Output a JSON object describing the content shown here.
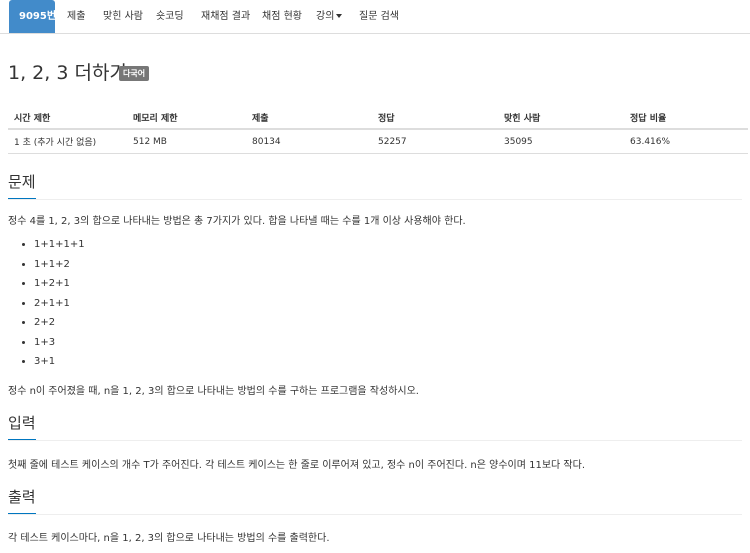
{
  "nav": {
    "tabs": [
      {
        "label": "9095번",
        "active": true
      },
      {
        "label": "제출"
      },
      {
        "label": "맞힌 사람"
      },
      {
        "label": "숏코딩"
      },
      {
        "label": "재채점 결과"
      },
      {
        "label": "채점 현황"
      },
      {
        "label": "강의",
        "dropdown": true
      },
      {
        "label": "질문 검색"
      }
    ]
  },
  "problem": {
    "title": "1, 2, 3 더하기",
    "badge": "다국어"
  },
  "info_table": {
    "headers": [
      "시간 제한",
      "메모리 제한",
      "제출",
      "정답",
      "맞힌 사람",
      "정답 비율"
    ],
    "values": [
      "1 초 (추가 시간 없음)",
      "512 MB",
      "80134",
      "52257",
      "35095",
      "63.416%"
    ]
  },
  "sections": {
    "problem": {
      "heading": "문제",
      "intro": "정수 4를 1, 2, 3의 합으로 나타내는 방법은 총 7가지가 있다. 합을 나타낼 때는 수를 1개 이상 사용해야 한다.",
      "items": [
        "1+1+1+1",
        "1+1+2",
        "1+2+1",
        "2+1+1",
        "2+2",
        "1+3",
        "3+1"
      ],
      "outro": "정수 n이 주어졌을 때, n을 1, 2, 3의 합으로 나타내는 방법의 수를 구하는 프로그램을 작성하시오."
    },
    "input": {
      "heading": "입력",
      "text": "첫째 줄에 테스트 케이스의 개수 T가 주어진다. 각 테스트 케이스는 한 줄로 이루어져 있고, 정수 n이 주어진다. n은 양수이며 11보다 작다."
    },
    "output": {
      "heading": "출력",
      "text": "각 테스트 케이스마다, n을 1, 2, 3의 합으로 나타내는 방법의 수를 출력한다."
    }
  },
  "colors": {
    "active_tab": "#428bca",
    "heading_underline": "#0076c0",
    "badge": "#777777"
  }
}
